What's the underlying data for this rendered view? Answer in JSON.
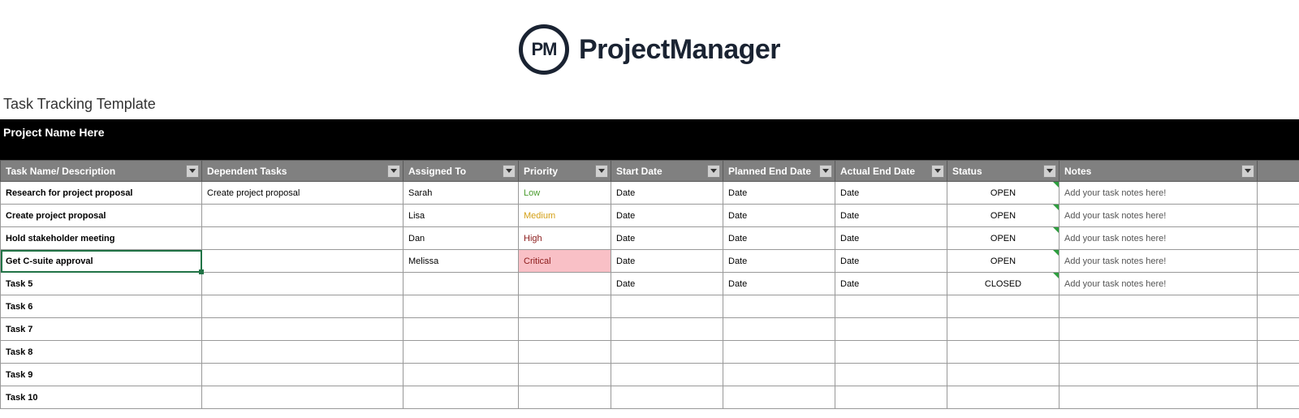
{
  "brand": {
    "logo_initials": "PM",
    "logo_text": "ProjectManager"
  },
  "subtitle": "Task Tracking Template",
  "project_name": "Project Name Here",
  "columns": [
    "Task Name/ Description",
    "Dependent Tasks",
    "Assigned To",
    "Priority",
    "Start Date",
    "Planned End Date",
    "Actual End Date",
    "Status",
    "Notes"
  ],
  "rows": [
    {
      "task": "Research for project proposal",
      "dependent": "Create project proposal",
      "assigned": "Sarah",
      "priority": "Low",
      "priority_class": "low",
      "start": "Date",
      "planned": "Date",
      "actual": "Date",
      "status": "OPEN",
      "notes": "Add your task notes here!"
    },
    {
      "task": "Create project proposal",
      "dependent": "",
      "assigned": "Lisa",
      "priority": "Medium",
      "priority_class": "medium",
      "start": "Date",
      "planned": "Date",
      "actual": "Date",
      "status": "OPEN",
      "notes": "Add your task notes here!"
    },
    {
      "task": "Hold stakeholder meeting",
      "dependent": "",
      "assigned": "Dan",
      "priority": "High",
      "priority_class": "high",
      "start": "Date",
      "planned": "Date",
      "actual": "Date",
      "status": "OPEN",
      "notes": "Add your task notes here!"
    },
    {
      "task": "Get C-suite approval",
      "dependent": "",
      "assigned": "Melissa",
      "priority": "Critical",
      "priority_class": "critical",
      "start": "Date",
      "planned": "Date",
      "actual": "Date",
      "status": "OPEN",
      "notes": "Add your task notes here!",
      "selected": true
    },
    {
      "task": "Task 5",
      "dependent": "",
      "assigned": "",
      "priority": "",
      "priority_class": "",
      "start": "Date",
      "planned": "Date",
      "actual": "Date",
      "status": "CLOSED",
      "notes": "Add your task notes here!"
    },
    {
      "task": "Task 6",
      "dependent": "",
      "assigned": "",
      "priority": "",
      "priority_class": "",
      "start": "",
      "planned": "",
      "actual": "",
      "status": "",
      "notes": ""
    },
    {
      "task": "Task 7",
      "dependent": "",
      "assigned": "",
      "priority": "",
      "priority_class": "",
      "start": "",
      "planned": "",
      "actual": "",
      "status": "",
      "notes": ""
    },
    {
      "task": "Task 8",
      "dependent": "",
      "assigned": "",
      "priority": "",
      "priority_class": "",
      "start": "",
      "planned": "",
      "actual": "",
      "status": "",
      "notes": ""
    },
    {
      "task": "Task 9",
      "dependent": "",
      "assigned": "",
      "priority": "",
      "priority_class": "",
      "start": "",
      "planned": "",
      "actual": "",
      "status": "",
      "notes": ""
    },
    {
      "task": "Task 10",
      "dependent": "",
      "assigned": "",
      "priority": "",
      "priority_class": "",
      "start": "",
      "planned": "",
      "actual": "",
      "status": "",
      "notes": ""
    }
  ]
}
